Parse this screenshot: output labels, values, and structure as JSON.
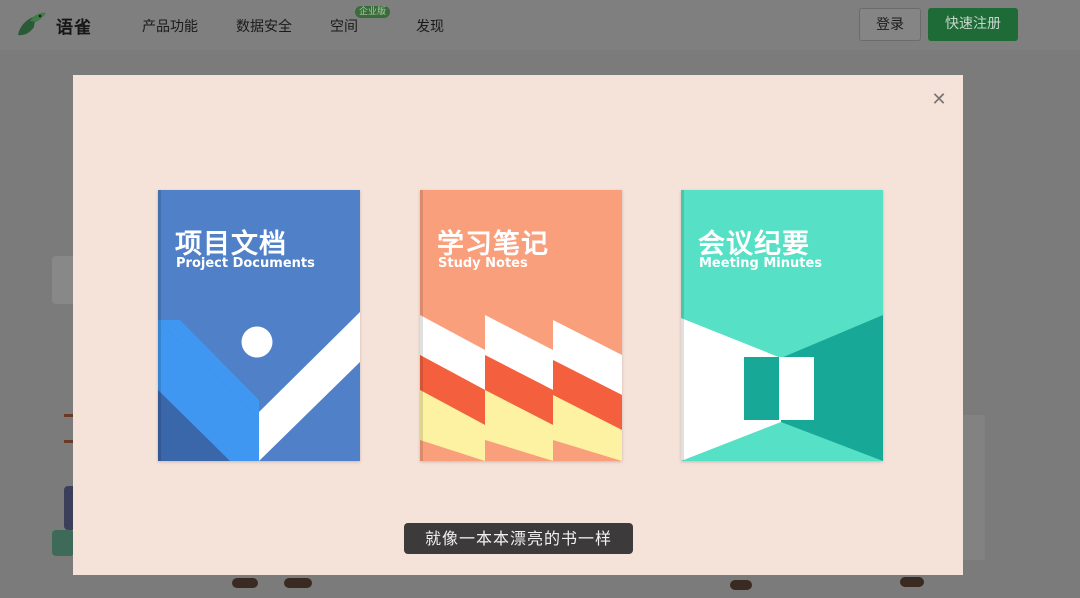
{
  "brand": {
    "name": "语雀",
    "logo_icon": "sparrow-bird-icon"
  },
  "nav": {
    "items": [
      {
        "label": "产品功能"
      },
      {
        "label": "数据安全"
      },
      {
        "label": "空间",
        "badge": "企业版"
      },
      {
        "label": "发现"
      }
    ]
  },
  "header": {
    "login_label": "登录",
    "register_label": "快速注册"
  },
  "modal": {
    "close_icon": "close-icon",
    "books": [
      {
        "title": "项目文档",
        "subtitle": "Project Documents",
        "color": "#4f80c8"
      },
      {
        "title": "学习笔记",
        "subtitle": "Study Notes",
        "color": "#fa9f7c"
      },
      {
        "title": "会议纪要",
        "subtitle": "Meeting Minutes",
        "color": "#56e0c5"
      }
    ]
  },
  "caption": "就像一本本漂亮的书一样",
  "colors": {
    "brand_green": "#25b864",
    "modal_bg": "#f5e2d9"
  }
}
